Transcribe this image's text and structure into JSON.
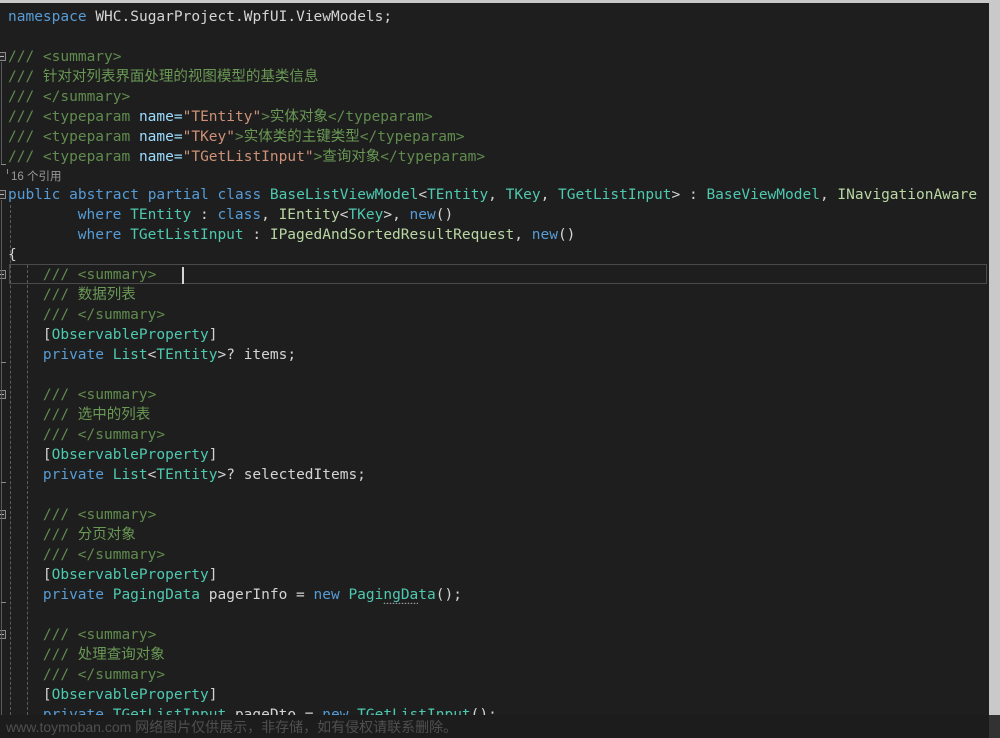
{
  "window": {
    "app": "Visual Studio Code Editor",
    "theme_background": "#1e1e1e",
    "scrollbar_color": "#c9c9c9"
  },
  "editor": {
    "language": "C#",
    "font_size_px": 14.5,
    "line_height_px": 20,
    "current_line_index": 13,
    "caret_line_text": "    /// <summary>",
    "colors": {
      "keyword": "#569cd6",
      "type": "#4ec9b0",
      "interface": "#b8d7a3",
      "comment": "#6a9955",
      "doc_tag": "#608b4e",
      "doc_attr_name": "#9cdcfe",
      "doc_attr_value": "#ce9178",
      "plain_text": "#d4d4d4",
      "background": "#1e1e1e",
      "current_line_border": "#4a4a4a",
      "indent_guide": "#5b5b5b",
      "codelens_text": "#9a9a9a"
    }
  },
  "codelens": {
    "label": "16 个引用",
    "line_index": 8
  },
  "code_lines": [
    {
      "i": 0,
      "indent": 0,
      "segments": [
        {
          "t": "namespace ",
          "c": "kw"
        },
        {
          "t": "WHC.SugarProject.WpfUI.ViewModels;",
          "c": "ns"
        }
      ]
    },
    {
      "i": 1,
      "indent": 0,
      "segments": []
    },
    {
      "i": 2,
      "indent": 0,
      "segments": [
        {
          "t": "/// ",
          "c": "doctag"
        },
        {
          "t": "<summary>",
          "c": "doctag"
        }
      ]
    },
    {
      "i": 3,
      "indent": 0,
      "segments": [
        {
          "t": "/// ",
          "c": "doctag"
        },
        {
          "t": "针对对列表界面处理的视图模型的基类信息",
          "c": "doctext"
        }
      ]
    },
    {
      "i": 4,
      "indent": 0,
      "segments": [
        {
          "t": "/// ",
          "c": "doctag"
        },
        {
          "t": "</summary>",
          "c": "doctag"
        }
      ]
    },
    {
      "i": 5,
      "indent": 0,
      "segments": [
        {
          "t": "/// ",
          "c": "doctag"
        },
        {
          "t": "<typeparam ",
          "c": "doctag"
        },
        {
          "t": "name=",
          "c": "docattr"
        },
        {
          "t": "\"TEntity\"",
          "c": "docstr"
        },
        {
          "t": ">",
          "c": "doctag"
        },
        {
          "t": "实体对象",
          "c": "doctext"
        },
        {
          "t": "</typeparam>",
          "c": "doctag"
        }
      ]
    },
    {
      "i": 6,
      "indent": 0,
      "segments": [
        {
          "t": "/// ",
          "c": "doctag"
        },
        {
          "t": "<typeparam ",
          "c": "doctag"
        },
        {
          "t": "name=",
          "c": "docattr"
        },
        {
          "t": "\"TKey\"",
          "c": "docstr"
        },
        {
          "t": ">",
          "c": "doctag"
        },
        {
          "t": "实体类的主键类型",
          "c": "doctext"
        },
        {
          "t": "</typeparam>",
          "c": "doctag"
        }
      ]
    },
    {
      "i": 7,
      "indent": 0,
      "segments": [
        {
          "t": "/// ",
          "c": "doctag"
        },
        {
          "t": "<typeparam ",
          "c": "doctag"
        },
        {
          "t": "name=",
          "c": "docattr"
        },
        {
          "t": "\"TGetListInput\"",
          "c": "docstr"
        },
        {
          "t": ">",
          "c": "doctag"
        },
        {
          "t": "查询对象",
          "c": "doctext"
        },
        {
          "t": "</typeparam>",
          "c": "doctag"
        }
      ]
    },
    {
      "i": 9,
      "indent": 0,
      "segments": [
        {
          "t": "public ",
          "c": "kw"
        },
        {
          "t": "abstract ",
          "c": "kw"
        },
        {
          "t": "partial ",
          "c": "kw"
        },
        {
          "t": "class ",
          "c": "kw"
        },
        {
          "t": "BaseListViewModel",
          "c": "type"
        },
        {
          "t": "<",
          "c": "punct"
        },
        {
          "t": "TEntity",
          "c": "type"
        },
        {
          "t": ", ",
          "c": "punct"
        },
        {
          "t": "TKey",
          "c": "type"
        },
        {
          "t": ", ",
          "c": "punct"
        },
        {
          "t": "TGetListInput",
          "c": "type"
        },
        {
          "t": "> : ",
          "c": "punct"
        },
        {
          "t": "BaseViewModel",
          "c": "type"
        },
        {
          "t": ", ",
          "c": "punct"
        },
        {
          "t": "INavigationAware",
          "c": "iface"
        }
      ]
    },
    {
      "i": 10,
      "indent": 8,
      "segments": [
        {
          "t": "where ",
          "c": "kw"
        },
        {
          "t": "TEntity",
          "c": "type"
        },
        {
          "t": " : ",
          "c": "punct"
        },
        {
          "t": "class",
          "c": "kw"
        },
        {
          "t": ", ",
          "c": "punct"
        },
        {
          "t": "IEntity",
          "c": "iface"
        },
        {
          "t": "<",
          "c": "punct"
        },
        {
          "t": "TKey",
          "c": "type"
        },
        {
          "t": ">, ",
          "c": "punct"
        },
        {
          "t": "new",
          "c": "kw"
        },
        {
          "t": "()",
          "c": "punct"
        }
      ]
    },
    {
      "i": 11,
      "indent": 8,
      "segments": [
        {
          "t": "where ",
          "c": "kw"
        },
        {
          "t": "TGetListInput",
          "c": "type"
        },
        {
          "t": " : ",
          "c": "punct"
        },
        {
          "t": "IPagedAndSortedResultRequest",
          "c": "iface"
        },
        {
          "t": ", ",
          "c": "punct"
        },
        {
          "t": "new",
          "c": "kw"
        },
        {
          "t": "()",
          "c": "punct"
        }
      ]
    },
    {
      "i": 12,
      "indent": 0,
      "segments": [
        {
          "t": "{",
          "c": "brace"
        }
      ]
    },
    {
      "i": 13,
      "indent": 4,
      "segments": [
        {
          "t": "/// ",
          "c": "doctag"
        },
        {
          "t": "<summary>",
          "c": "doctag"
        }
      ]
    },
    {
      "i": 14,
      "indent": 4,
      "segments": [
        {
          "t": "/// ",
          "c": "doctag"
        },
        {
          "t": "数据列表",
          "c": "doctext"
        }
      ]
    },
    {
      "i": 15,
      "indent": 4,
      "segments": [
        {
          "t": "/// ",
          "c": "doctag"
        },
        {
          "t": "</summary>",
          "c": "doctag"
        }
      ]
    },
    {
      "i": 16,
      "indent": 4,
      "segments": [
        {
          "t": "[",
          "c": "punct"
        },
        {
          "t": "ObservableProperty",
          "c": "attr"
        },
        {
          "t": "]",
          "c": "punct"
        }
      ]
    },
    {
      "i": 17,
      "indent": 4,
      "segments": [
        {
          "t": "private ",
          "c": "kw"
        },
        {
          "t": "List",
          "c": "type"
        },
        {
          "t": "<",
          "c": "punct"
        },
        {
          "t": "TEntity",
          "c": "type"
        },
        {
          "t": ">? ",
          "c": "punct"
        },
        {
          "t": "items;",
          "c": "ident"
        }
      ]
    },
    {
      "i": 19,
      "indent": 4,
      "segments": [
        {
          "t": "/// ",
          "c": "doctag"
        },
        {
          "t": "<summary>",
          "c": "doctag"
        }
      ]
    },
    {
      "i": 20,
      "indent": 4,
      "segments": [
        {
          "t": "/// ",
          "c": "doctag"
        },
        {
          "t": "选中的列表",
          "c": "doctext"
        }
      ]
    },
    {
      "i": 21,
      "indent": 4,
      "segments": [
        {
          "t": "/// ",
          "c": "doctag"
        },
        {
          "t": "</summary>",
          "c": "doctag"
        }
      ]
    },
    {
      "i": 22,
      "indent": 4,
      "segments": [
        {
          "t": "[",
          "c": "punct"
        },
        {
          "t": "ObservableProperty",
          "c": "attr"
        },
        {
          "t": "]",
          "c": "punct"
        }
      ]
    },
    {
      "i": 23,
      "indent": 4,
      "segments": [
        {
          "t": "private ",
          "c": "kw"
        },
        {
          "t": "List",
          "c": "type"
        },
        {
          "t": "<",
          "c": "punct"
        },
        {
          "t": "TEntity",
          "c": "type"
        },
        {
          "t": ">? ",
          "c": "punct"
        },
        {
          "t": "selectedItems;",
          "c": "ident"
        }
      ]
    },
    {
      "i": 25,
      "indent": 4,
      "segments": [
        {
          "t": "/// ",
          "c": "doctag"
        },
        {
          "t": "<summary>",
          "c": "doctag"
        }
      ]
    },
    {
      "i": 26,
      "indent": 4,
      "segments": [
        {
          "t": "/// ",
          "c": "doctag"
        },
        {
          "t": "分页对象",
          "c": "doctext"
        }
      ]
    },
    {
      "i": 27,
      "indent": 4,
      "segments": [
        {
          "t": "/// ",
          "c": "doctag"
        },
        {
          "t": "</summary>",
          "c": "doctag"
        }
      ]
    },
    {
      "i": 28,
      "indent": 4,
      "segments": [
        {
          "t": "[",
          "c": "punct"
        },
        {
          "t": "ObservableProperty",
          "c": "attr"
        },
        {
          "t": "]",
          "c": "punct"
        }
      ]
    },
    {
      "i": 29,
      "indent": 4,
      "segments": [
        {
          "t": "private ",
          "c": "kw"
        },
        {
          "t": "PagingData",
          "c": "type"
        },
        {
          "t": " pagerInfo = ",
          "c": "ident"
        },
        {
          "t": "new ",
          "c": "kw"
        },
        {
          "t": "PagingData",
          "c": "type"
        },
        {
          "t": "();",
          "c": "punct"
        }
      ]
    },
    {
      "i": 31,
      "indent": 4,
      "segments": [
        {
          "t": "/// ",
          "c": "doctag"
        },
        {
          "t": "<summary>",
          "c": "doctag"
        }
      ]
    },
    {
      "i": 32,
      "indent": 4,
      "segments": [
        {
          "t": "/// ",
          "c": "doctag"
        },
        {
          "t": "处理查询对象",
          "c": "doctext"
        }
      ]
    },
    {
      "i": 33,
      "indent": 4,
      "segments": [
        {
          "t": "/// ",
          "c": "doctag"
        },
        {
          "t": "</summary>",
          "c": "doctag"
        }
      ]
    },
    {
      "i": 34,
      "indent": 4,
      "segments": [
        {
          "t": "[",
          "c": "punct"
        },
        {
          "t": "ObservableProperty",
          "c": "attr"
        },
        {
          "t": "]",
          "c": "punct"
        }
      ]
    },
    {
      "i": 35,
      "indent": 4,
      "segments": [
        {
          "t": "private ",
          "c": "kw"
        },
        {
          "t": "TGetListInput",
          "c": "type"
        },
        {
          "t": " pageDto = ",
          "c": "ident"
        },
        {
          "t": "new ",
          "c": "kw"
        },
        {
          "t": "TGetListInput",
          "c": "type"
        },
        {
          "t": "();",
          "c": "punct"
        }
      ]
    }
  ],
  "outlining": [
    {
      "name": "doc-comment-region",
      "line": 2,
      "collapsed": false
    },
    {
      "name": "class-region",
      "line": 9,
      "collapsed": false
    },
    {
      "name": "member-region-items",
      "line": 13,
      "collapsed": false
    },
    {
      "name": "member-region-selecteditems",
      "line": 19,
      "collapsed": false
    },
    {
      "name": "member-region-pagerinfo",
      "line": 25,
      "collapsed": false
    },
    {
      "name": "member-region-pagedto",
      "line": 31,
      "collapsed": false
    }
  ],
  "squiggles": [
    {
      "name": "pagingdata-suggestion",
      "line": 29,
      "col": 43,
      "len": 10
    },
    {
      "name": "tgetlistinput-suggestion",
      "line": 35,
      "col": 43,
      "len": 13
    }
  ],
  "watermark": {
    "text": "www.toymoban.com 网络图片仅供展示，非存储，如有侵权请联系删除。"
  }
}
